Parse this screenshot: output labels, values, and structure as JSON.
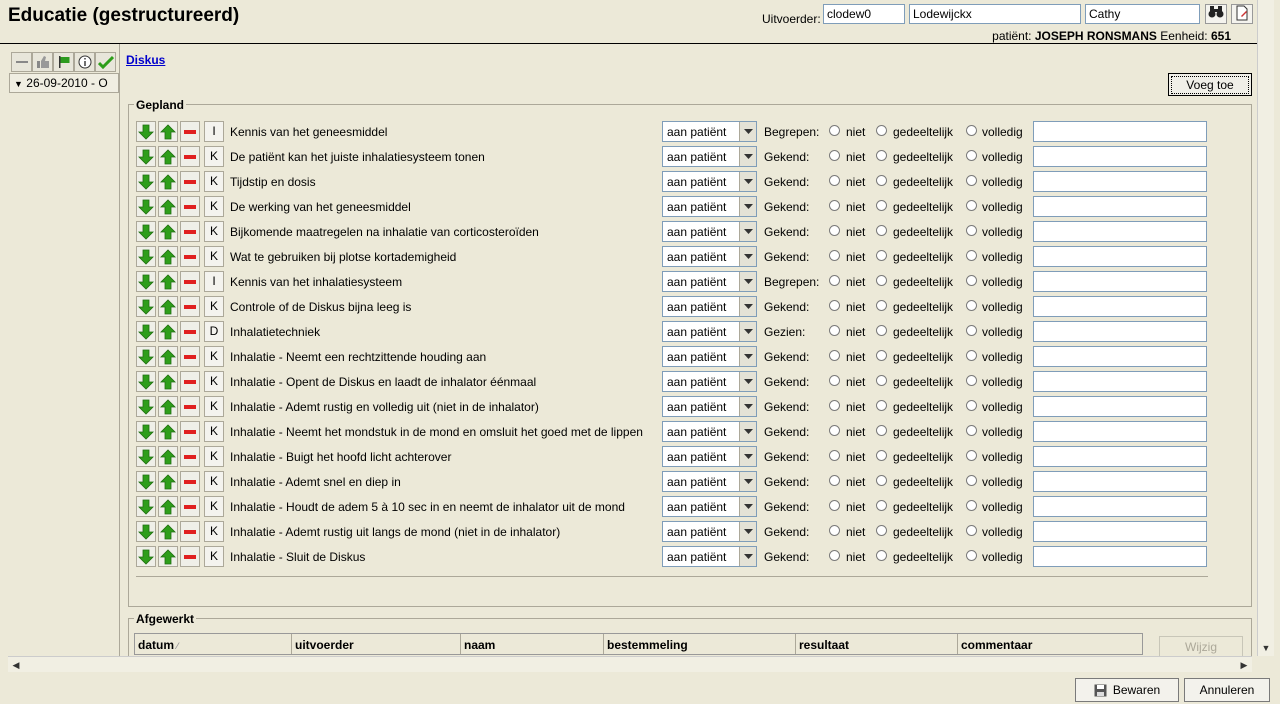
{
  "header": {
    "title": "Educatie (gestructureerd)",
    "executor_label": "Uitvoerder:",
    "executor_code": "clodew0",
    "executor_lastname": "Lodewijckx",
    "executor_firstname": "Cathy",
    "patient_label": "patiënt:",
    "patient_name": "JOSEPH RONSMANS",
    "unit_label": "Eenheid:",
    "unit_value": "651"
  },
  "left": {
    "date_entry": "26-09-2010  - O"
  },
  "main": {
    "link": "Diskus",
    "add_button": "Voeg toe",
    "planned_legend": "Gepland",
    "completed_legend": "Afgewerkt",
    "radio_labels": [
      "niet",
      "gedeeltelijk",
      "volledig"
    ],
    "items": [
      {
        "letter": "I",
        "text": "Kennis van het geneesmiddel",
        "target": "aan patiënt",
        "kind": "Begrepen:"
      },
      {
        "letter": "K",
        "text": "De patiënt kan het juiste inhalatiesysteem tonen",
        "target": "aan patiënt",
        "kind": "Gekend:"
      },
      {
        "letter": "K",
        "text": "Tijdstip en dosis",
        "target": "aan patiënt",
        "kind": "Gekend:"
      },
      {
        "letter": "K",
        "text": "De werking van het geneesmiddel",
        "target": "aan patiënt",
        "kind": "Gekend:"
      },
      {
        "letter": "K",
        "text": "Bijkomende maatregelen na inhalatie van corticosteroïden",
        "target": "aan patiënt",
        "kind": "Gekend:"
      },
      {
        "letter": "K",
        "text": "Wat te gebruiken bij plotse kortademigheid",
        "target": "aan patiënt",
        "kind": "Gekend:"
      },
      {
        "letter": "I",
        "text": "Kennis van het inhalatiesysteem",
        "target": "aan patiënt",
        "kind": "Begrepen:"
      },
      {
        "letter": "K",
        "text": "Controle of de Diskus bijna leeg is",
        "target": "aan patiënt",
        "kind": "Gekend:"
      },
      {
        "letter": "D",
        "text": "Inhalatietechniek",
        "target": "aan patiënt",
        "kind": "Gezien:"
      },
      {
        "letter": "K",
        "text": "Inhalatie - Neemt een rechtzittende houding aan",
        "target": "aan patiënt",
        "kind": "Gekend:"
      },
      {
        "letter": "K",
        "text": "Inhalatie - Opent de Diskus en laadt de inhalator éénmaal",
        "target": "aan patiënt",
        "kind": "Gekend:"
      },
      {
        "letter": "K",
        "text": "Inhalatie - Ademt rustig en volledig uit (niet in de inhalator)",
        "target": "aan patiënt",
        "kind": "Gekend:"
      },
      {
        "letter": "K",
        "text": "Inhalatie - Neemt het mondstuk in de mond en omsluit het goed met de lippen",
        "target": "aan patiënt",
        "kind": "Gekend:"
      },
      {
        "letter": "K",
        "text": "Inhalatie - Buigt het hoofd licht achterover",
        "target": "aan patiënt",
        "kind": "Gekend:"
      },
      {
        "letter": "K",
        "text": "Inhalatie - Ademt snel en diep in",
        "target": "aan patiënt",
        "kind": "Gekend:"
      },
      {
        "letter": "K",
        "text": "Inhalatie - Houdt de adem 5 à 10 sec in en neemt de inhalator uit de mond",
        "target": "aan patiënt",
        "kind": "Gekend:"
      },
      {
        "letter": "K",
        "text": "Inhalatie - Ademt rustig uit langs de mond (niet in de inhalator)",
        "target": "aan patiënt",
        "kind": "Gekend:"
      },
      {
        "letter": "K",
        "text": "Inhalatie - Sluit de Diskus",
        "target": "aan patiënt",
        "kind": "Gekend:"
      }
    ]
  },
  "completed_table": {
    "columns": [
      "datum",
      "uitvoerder",
      "naam",
      "bestemmeling",
      "resultaat",
      "commentaar"
    ],
    "edit_button": "Wijzig"
  },
  "footer": {
    "save_button": "Bewaren",
    "cancel_button": "Annuleren"
  },
  "icons": {
    "toolbar": [
      "minus-icon",
      "thumbs-up-icon",
      "flag-icon",
      "info-icon",
      "checkmark-icon"
    ],
    "row": [
      "arrow-down-icon",
      "arrow-up-icon",
      "remove-icon"
    ],
    "search": "binoculars-icon",
    "edit": "document-edit-icon",
    "save": "floppy-icon"
  },
  "colors": {
    "arrow_green": "#2e9e1a",
    "remove_red": "#e02020",
    "link_blue": "#0000cc",
    "panel_bg": "#ece9d8"
  }
}
